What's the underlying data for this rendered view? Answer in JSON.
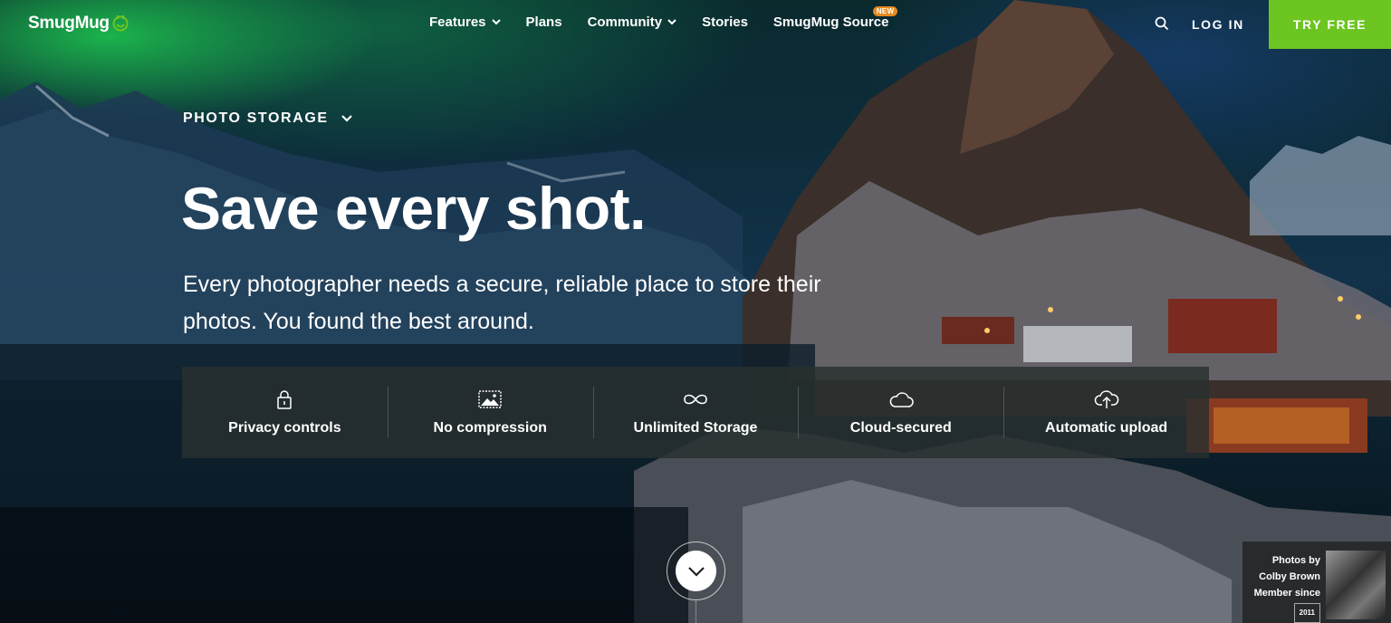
{
  "header": {
    "logo": "SmugMug",
    "nav": [
      {
        "label": "Features",
        "has_dropdown": true
      },
      {
        "label": "Plans",
        "has_dropdown": false
      },
      {
        "label": "Community",
        "has_dropdown": true
      },
      {
        "label": "Stories",
        "has_dropdown": false
      },
      {
        "label": "SmugMug Source",
        "has_dropdown": false,
        "badge": "NEW"
      }
    ],
    "login": "LOG IN",
    "cta": "TRY FREE"
  },
  "hero": {
    "eyebrow": "PHOTO STORAGE",
    "headline": "Save every shot.",
    "subtext": "Every photographer needs a secure, reliable place to store their photos. You found the best around."
  },
  "features": [
    {
      "label": "Privacy controls",
      "icon": "lock-icon"
    },
    {
      "label": "No compression",
      "icon": "image-icon"
    },
    {
      "label": "Unlimited Storage",
      "icon": "infinity-icon"
    },
    {
      "label": "Cloud-secured",
      "icon": "cloud-icon"
    },
    {
      "label": "Automatic upload",
      "icon": "cloud-upload-icon"
    }
  ],
  "credit": {
    "line1": "Photos by",
    "line2": "Colby Brown",
    "line3": "Member since",
    "year": "2011"
  },
  "colors": {
    "accent": "#6cc521",
    "badge": "#e58a1f",
    "feature_bar": "#283030"
  }
}
